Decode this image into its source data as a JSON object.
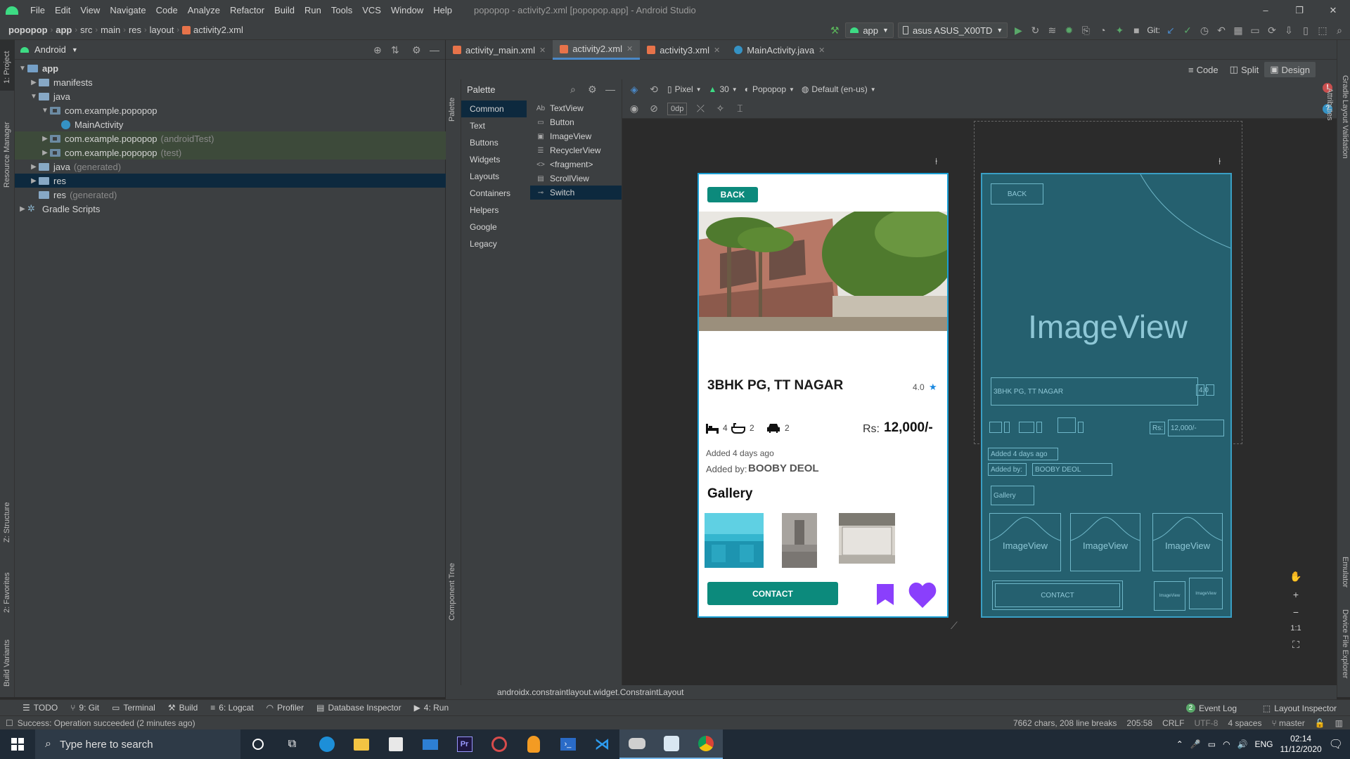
{
  "menubar": {
    "items": [
      "File",
      "Edit",
      "View",
      "Navigate",
      "Code",
      "Analyze",
      "Refactor",
      "Build",
      "Run",
      "Tools",
      "VCS",
      "Window",
      "Help"
    ],
    "window_title": "popopop - activity2.xml [popopop.app] - Android Studio",
    "min": "–",
    "max": "❐",
    "close": "✕"
  },
  "navbar": {
    "crumbs": [
      "popopop",
      "app",
      "src",
      "main",
      "res",
      "layout",
      "activity2.xml"
    ],
    "run_config": "app",
    "device": "asus ASUS_X00TD",
    "git_label": "Git:"
  },
  "sidestripe": {
    "project": "1: Project",
    "resource_manager": "Resource Manager",
    "structure": "Z: Structure",
    "favorites": "2: Favorites",
    "build_variants": "Build Variants",
    "gradle": "Gradle",
    "layout_validation": "Layout Validation",
    "attributes": "Attributes",
    "emulator": "Emulator",
    "device_file_explorer": "Device File Explorer",
    "palette": "Palette",
    "component_tree": "Component Tree"
  },
  "project": {
    "view_mode": "Android",
    "tree": [
      {
        "label": "app",
        "dim": ""
      },
      {
        "label": "manifests",
        "dim": ""
      },
      {
        "label": "java",
        "dim": ""
      },
      {
        "label": "com.example.popopop",
        "dim": ""
      },
      {
        "label": "MainActivity",
        "dim": ""
      },
      {
        "label": "com.example.popopop",
        "dim": "(androidTest)"
      },
      {
        "label": "com.example.popopop",
        "dim": "(test)"
      },
      {
        "label": "java",
        "dim": "(generated)"
      },
      {
        "label": "res",
        "dim": ""
      },
      {
        "label": "res",
        "dim": "(generated)"
      },
      {
        "label": "Gradle Scripts",
        "dim": ""
      }
    ]
  },
  "tabs": [
    "activity_main.xml",
    "activity2.xml",
    "activity3.xml",
    "MainActivity.java"
  ],
  "design_modes": [
    "Code",
    "Split",
    "Design"
  ],
  "palette": {
    "title": "Palette",
    "categories": [
      "Common",
      "Text",
      "Buttons",
      "Widgets",
      "Layouts",
      "Containers",
      "Helpers",
      "Google",
      "Legacy"
    ],
    "items": [
      {
        "icon": "Ab",
        "label": "TextView"
      },
      {
        "icon": "▭",
        "label": "Button"
      },
      {
        "icon": "▣",
        "label": "ImageView"
      },
      {
        "icon": "☰",
        "label": "RecyclerView"
      },
      {
        "icon": "<>",
        "label": "<fragment>"
      },
      {
        "icon": "▤",
        "label": "ScrollView"
      },
      {
        "icon": "⊸",
        "label": "Switch"
      }
    ]
  },
  "canvas_toolbar": {
    "device": "Pixel",
    "api": "30",
    "theme": "Popopop",
    "locale": "Default (en-us)",
    "margin": "0dp"
  },
  "phone": {
    "back": "BACK",
    "title": "3BHK PG, TT NAGAR",
    "rating": "4.0",
    "beds": "4",
    "baths": "2",
    "cars": "2",
    "rs": "Rs:",
    "price": "12,000/-",
    "added": "Added 4 days ago",
    "added_by": "Added by:",
    "owner": "BOOBY DEOL",
    "gallery": "Gallery",
    "contact": "CONTACT"
  },
  "blueprint": {
    "back": "BACK",
    "imageview": "ImageView",
    "title": "3BHK PG, TT NAGAR",
    "rating": "4.0",
    "rs": "Rs:",
    "price": "12,000/-",
    "added": "Added 4 days ago",
    "added_by": "Added by:",
    "owner": "BOOBY DEOL",
    "gallery": "Gallery",
    "thumb": "ImageView",
    "contact": "CONTACT"
  },
  "component_class": "androidx.constraintlayout.widget.ConstraintLayout",
  "bottom_tools": {
    "todo": "TODO",
    "git": "9: Git",
    "terminal": "Terminal",
    "build": "Build",
    "logcat": "6: Logcat",
    "profiler": "Profiler",
    "db": "Database Inspector",
    "run": "4: Run",
    "event_log": "Event Log",
    "event_badge": "2",
    "layout_inspector": "Layout Inspector"
  },
  "status": {
    "message": "Success: Operation succeeded (2 minutes ago)",
    "chars": "7662 chars, 208 line breaks",
    "pos": "205:58",
    "eol": "CRLF",
    "enc": "UTF-8",
    "indent": "4 spaces",
    "branch": "master"
  },
  "taskbar": {
    "search_placeholder": "Type here to search",
    "lang": "ENG",
    "time": "02:14",
    "date": "11/12/2020"
  },
  "colors": {
    "teal": "#0c8a7c",
    "purple": "#8a3ffc",
    "blueprint": "#25606f",
    "ide_bg": "#2b2b2b"
  }
}
